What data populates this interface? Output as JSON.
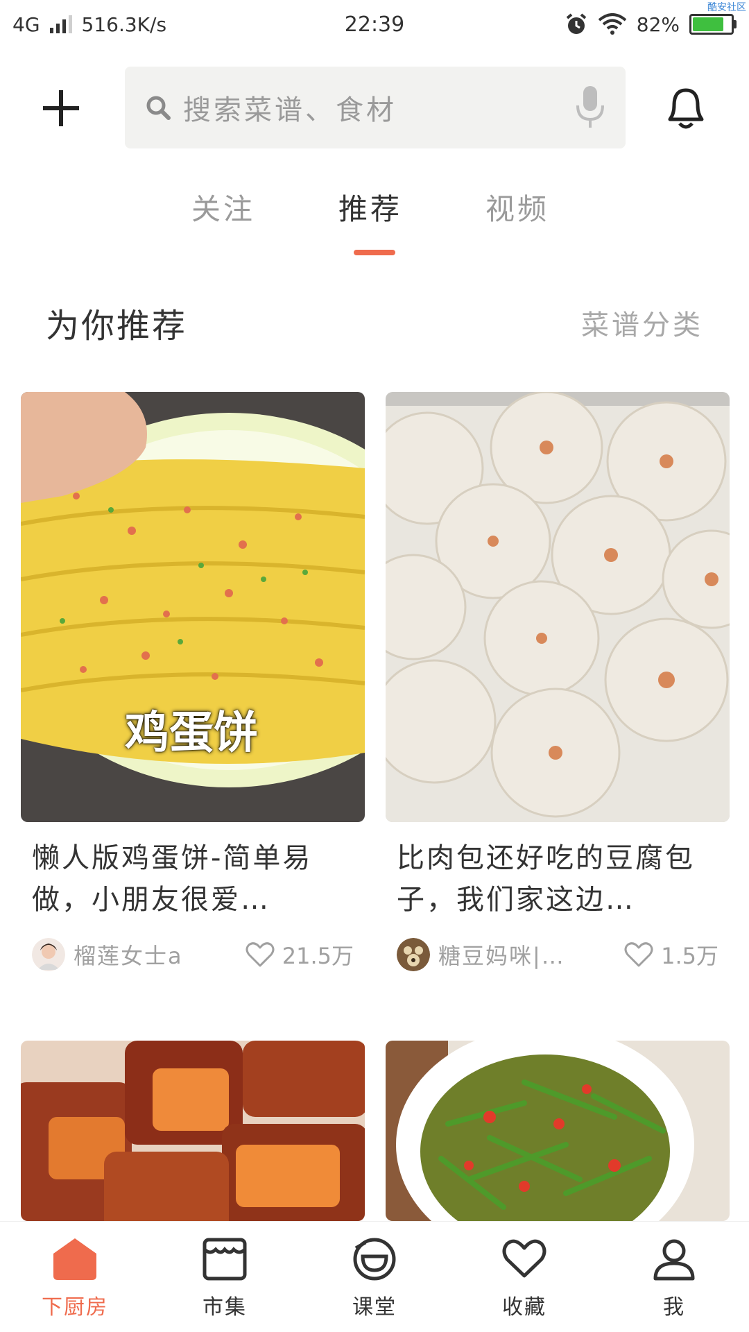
{
  "status_bar": {
    "network": "4G",
    "speed": "516.3K/s",
    "time": "22:39",
    "battery": "82%",
    "watermark": "酷安社区"
  },
  "search": {
    "placeholder": "搜索菜谱、食材"
  },
  "tabs": [
    {
      "label": "关注",
      "active": false
    },
    {
      "label": "推荐",
      "active": true
    },
    {
      "label": "视频",
      "active": false
    }
  ],
  "section": {
    "title": "为你推荐",
    "link": "菜谱分类"
  },
  "cards": [
    {
      "image_label": "鸡蛋饼",
      "title": "懒人版鸡蛋饼-简单易做，小朋友很爱…",
      "author": "榴莲女士a",
      "likes": "21.5万"
    },
    {
      "title": "比肉包还好吃的豆腐包子，我们家这边…",
      "author": "糖豆妈咪|…",
      "likes": "1.5万"
    }
  ],
  "bottom_nav": [
    {
      "label": "下厨房",
      "icon": "home-icon",
      "active": true
    },
    {
      "label": "市集",
      "icon": "market-icon",
      "active": false
    },
    {
      "label": "课堂",
      "icon": "classroom-icon",
      "active": false
    },
    {
      "label": "收藏",
      "icon": "heart-icon",
      "active": false
    },
    {
      "label": "我",
      "icon": "person-icon",
      "active": false
    }
  ],
  "colors": {
    "accent": "#ef6b4d",
    "text": "#333333",
    "muted": "#9a9a9a",
    "search_bg": "#f2f2f0"
  }
}
